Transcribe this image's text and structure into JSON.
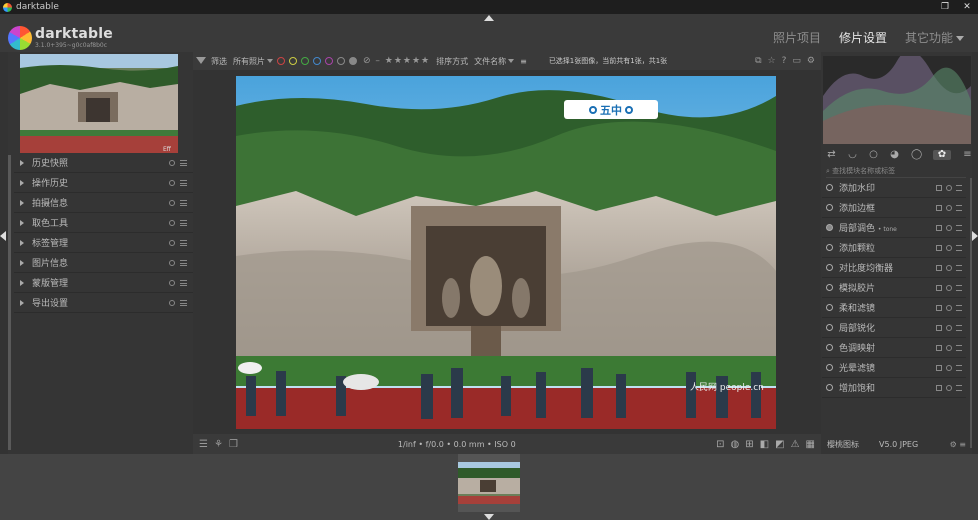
{
  "window": {
    "title": "darktable"
  },
  "header": {
    "app_name": "darktable",
    "version": "3.1.0+395~g0c0af8b0c",
    "views": [
      {
        "label": "照片项目",
        "active": false
      },
      {
        "label": "修片设置",
        "active": true
      },
      {
        "label": "其它功能",
        "active": false
      }
    ]
  },
  "left_panel": {
    "thumb_label": "Eff",
    "modules": [
      {
        "label": "历史快照"
      },
      {
        "label": "操作历史"
      },
      {
        "label": "拍摄信息"
      },
      {
        "label": "取色工具"
      },
      {
        "label": "标签管理"
      },
      {
        "label": "图片信息"
      },
      {
        "label": "蒙版管理"
      },
      {
        "label": "导出设置"
      }
    ]
  },
  "filterbar": {
    "filter_label": "筛选",
    "filter_value": "所有照片",
    "sort_label": "排序方式",
    "sort_value": "文件名称",
    "status": "已选择1张图像，当前共有1张，共1张"
  },
  "overlay": {
    "text": "五中"
  },
  "bottombar": {
    "exif": "1/inf • f/0.0 • 0.0 mm • ISO 0"
  },
  "right_panel": {
    "search_placeholder": "查找模块名称或标签",
    "modules": [
      {
        "label": "添加水印",
        "sub": ""
      },
      {
        "label": "添加边框",
        "sub": ""
      },
      {
        "label": "局部调色",
        "sub": "• tone"
      },
      {
        "label": "添加颗粒",
        "sub": ""
      },
      {
        "label": "对比度均衡器",
        "sub": ""
      },
      {
        "label": "模拟胶片",
        "sub": ""
      },
      {
        "label": "柔和滤镜",
        "sub": ""
      },
      {
        "label": "局部锐化",
        "sub": ""
      },
      {
        "label": "色调映射",
        "sub": ""
      },
      {
        "label": "光晕滤镜",
        "sub": ""
      },
      {
        "label": "增加饱和",
        "sub": ""
      }
    ],
    "footer_left": "樱桃图标",
    "footer_right": "V5.0 JPEG"
  },
  "watermark": {
    "text": "人民网 people.cn"
  },
  "colors": {
    "accent": "#1a6fb4",
    "panel": "#353535",
    "background": "#333333"
  }
}
